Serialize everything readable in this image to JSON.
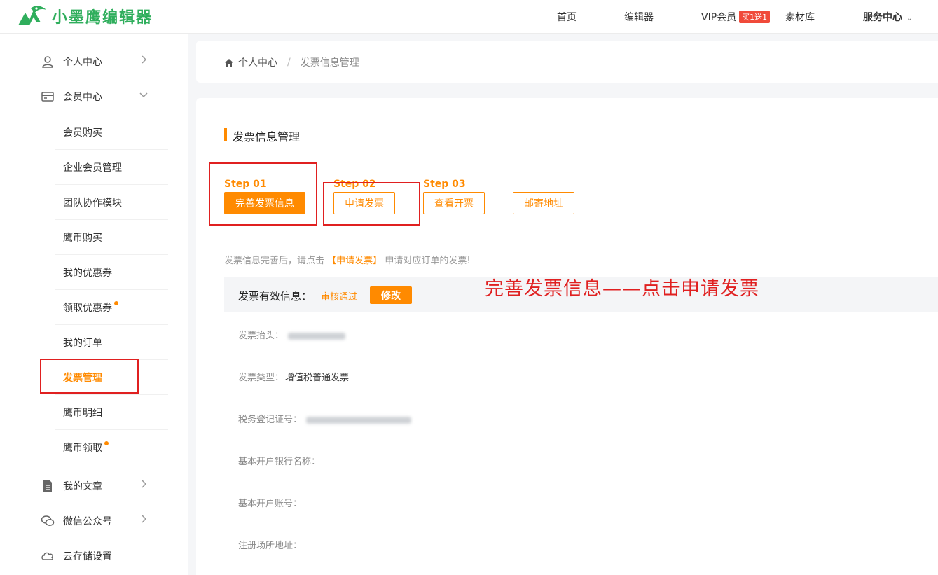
{
  "brand": {
    "name": "小墨鹰编辑器",
    "color": "#2fae5c"
  },
  "nav": {
    "home": "首页",
    "editor": "编辑器",
    "vip": "VIP会员",
    "vip_badge": "买1送1",
    "materials": "素材库",
    "service": "服务中心",
    "service_chevron": "⌄"
  },
  "sidebar": {
    "personal": "个人中心",
    "member": "会员中心",
    "sub_items": [
      "会员购买",
      "企业会员管理",
      "团队协作模块",
      "鹰币购买",
      "我的优惠券",
      "领取优惠券",
      "我的订单",
      "发票管理",
      "鹰币明细",
      "鹰币领取"
    ],
    "articles": "我的文章",
    "wechat": "微信公众号",
    "cloud": "云存储设置"
  },
  "breadcrumb": {
    "home": "个人中心",
    "separator": "/",
    "current": "发票信息管理"
  },
  "section_title": "发票信息管理",
  "steps": {
    "step1_label": "Step 01",
    "step1_button": "完善发票信息",
    "step2_label": "Step 02",
    "step2_button": "申请发票",
    "step3_label": "Step 03",
    "step3_button": "查看开票",
    "mail_button": "邮寄地址"
  },
  "tip": {
    "before": "发票信息完善后，请点击",
    "highlight": "【申请发票】",
    "after": "申请对应订单的发票!"
  },
  "annotation": "完善发票信息——点击申请发票",
  "valid": {
    "title": "发票有效信息：",
    "status": "审核通过",
    "edit_button": "修改"
  },
  "fields": {
    "title_label": "发票抬头：",
    "type_label": "发票类型：",
    "type_value": "增值税普通发票",
    "tax_label": "税务登记证号：",
    "bank_label": "基本开户银行名称：",
    "account_label": "基本开户账号：",
    "address_label": "注册场所地址："
  },
  "colors": {
    "accent": "#ff8a00",
    "annotation": "#e02020"
  }
}
